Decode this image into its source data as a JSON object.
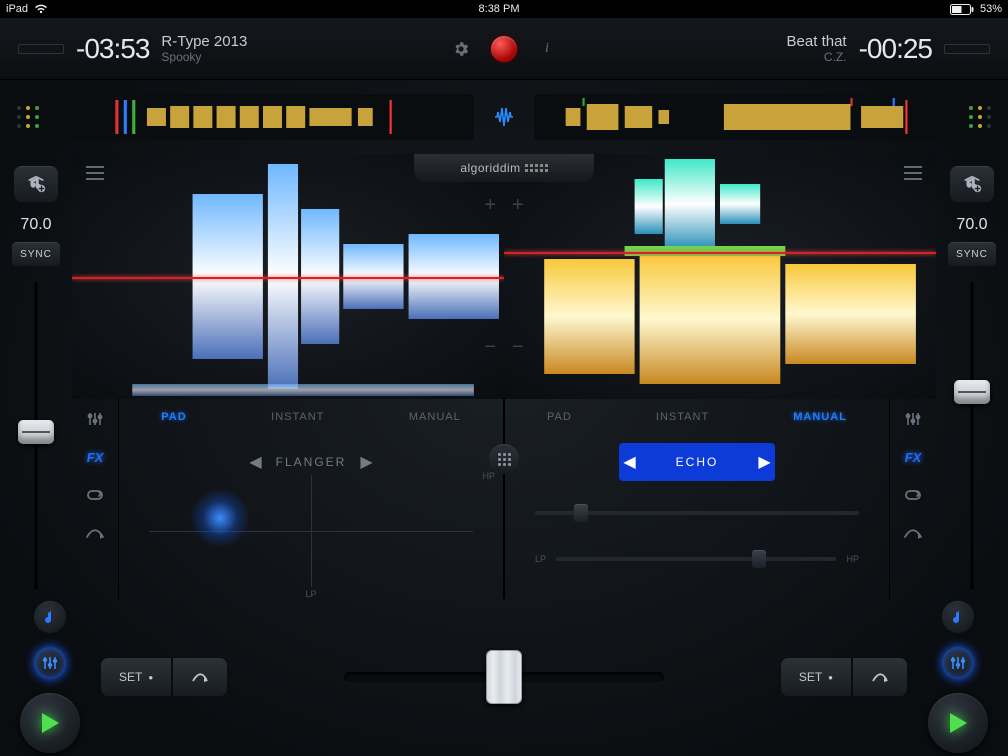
{
  "statusbar": {
    "device": "iPad",
    "time": "8:38 PM",
    "battery_pct": "53%"
  },
  "deckA": {
    "time": "-03:53",
    "track_title": "R-Type 2013",
    "track_artist": "Spooky",
    "bpm": "70.0",
    "sync_label": "SYNC",
    "fx_tabs": {
      "pad": "PAD",
      "instant": "INSTANT",
      "manual": "MANUAL"
    },
    "fx_active_tab": "PAD",
    "fx_name": "FLANGER",
    "fx_labels": {
      "hp": "HP",
      "lp": "LP"
    },
    "cue_set": "SET",
    "fx_button": "FX"
  },
  "deckB": {
    "time": "-00:25",
    "track_title": "Beat that",
    "track_artist": "C.Z.",
    "bpm": "70.0",
    "sync_label": "SYNC",
    "fx_tabs": {
      "pad": "PAD",
      "instant": "INSTANT",
      "manual": "MANUAL"
    },
    "fx_active_tab": "MANUAL",
    "fx_name": "ECHO",
    "fx_labels": {
      "hp": "HP",
      "lp": "LP"
    },
    "cue_set": "SET",
    "fx_button": "FX"
  },
  "brand": "algoriddim"
}
